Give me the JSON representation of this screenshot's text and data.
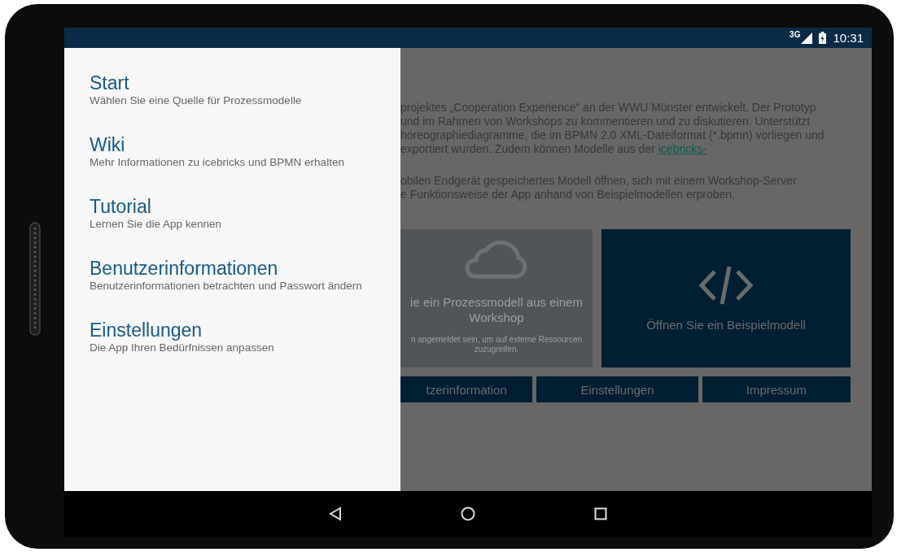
{
  "status_bar": {
    "network": "3G",
    "time": "10:31"
  },
  "content": {
    "paragraphs": [
      {
        "lines": [
          "projektes „Cooperation Experience“ an der WWU Münster entwickelt. Der Prototyp",
          "und im Rahmen von Workshops zu kommentieren und zu diskutieren. Unterstützt",
          "horeographiediagramme, die im BPMN 2.0 XML-Dateiformat (*.bpmn) vorliegen und",
          "exportiert wurden. Zudem können Modelle aus der "
        ],
        "link": "icebricks-"
      },
      {
        "lines": [
          "obilen Endgerät gespeichertes Modell öffnen, sich mit einem Workshop-Server",
          "e Funktionsweise der App anhand von Beispielmodellen erproben."
        ]
      }
    ],
    "cards": [
      {
        "kind": "cloud",
        "disabled": true,
        "title": "ie ein Prozessmodell aus einem Workshop",
        "note": "n angemeldet sein, um auf externe Ressourcen zuzugreifen."
      },
      {
        "kind": "code",
        "disabled": false,
        "title": "Öffnen Sie ein Beispielmodell"
      }
    ],
    "buttons": [
      "tzerinformation",
      "Einstellungen",
      "Impressum"
    ]
  },
  "drawer": {
    "items": [
      {
        "title": "Start",
        "subtitle": "Wählen Sie eine Quelle für Prozessmodelle"
      },
      {
        "title": "Wiki",
        "subtitle": "Mehr Informationen zu icebricks und BPMN erhalten"
      },
      {
        "title": "Tutorial",
        "subtitle": "Lernen Sie die App kennen"
      },
      {
        "title": "Benutzerinformationen",
        "subtitle": "Benutzerinformationen betrachten und Passwort ändern"
      },
      {
        "title": "Einstellungen",
        "subtitle": "Die App Ihren Bedürfnissen anpassen"
      }
    ]
  }
}
